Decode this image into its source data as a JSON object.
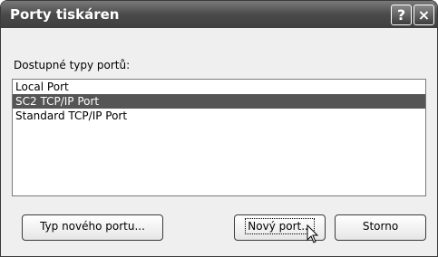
{
  "window": {
    "title": "Porty tiskáren"
  },
  "titlebar": {
    "help_icon": "?",
    "close_icon": "×"
  },
  "section": {
    "label": "Dostupné typy portů:"
  },
  "ports": [
    {
      "label": "Local Port",
      "selected": false
    },
    {
      "label": "SC2 TCP/IP Port",
      "selected": true
    },
    {
      "label": "Standard TCP/IP Port",
      "selected": false
    }
  ],
  "buttons": {
    "new_port_type": "Typ nového portu...",
    "new_port": "Nový port...",
    "cancel": "Storno"
  }
}
